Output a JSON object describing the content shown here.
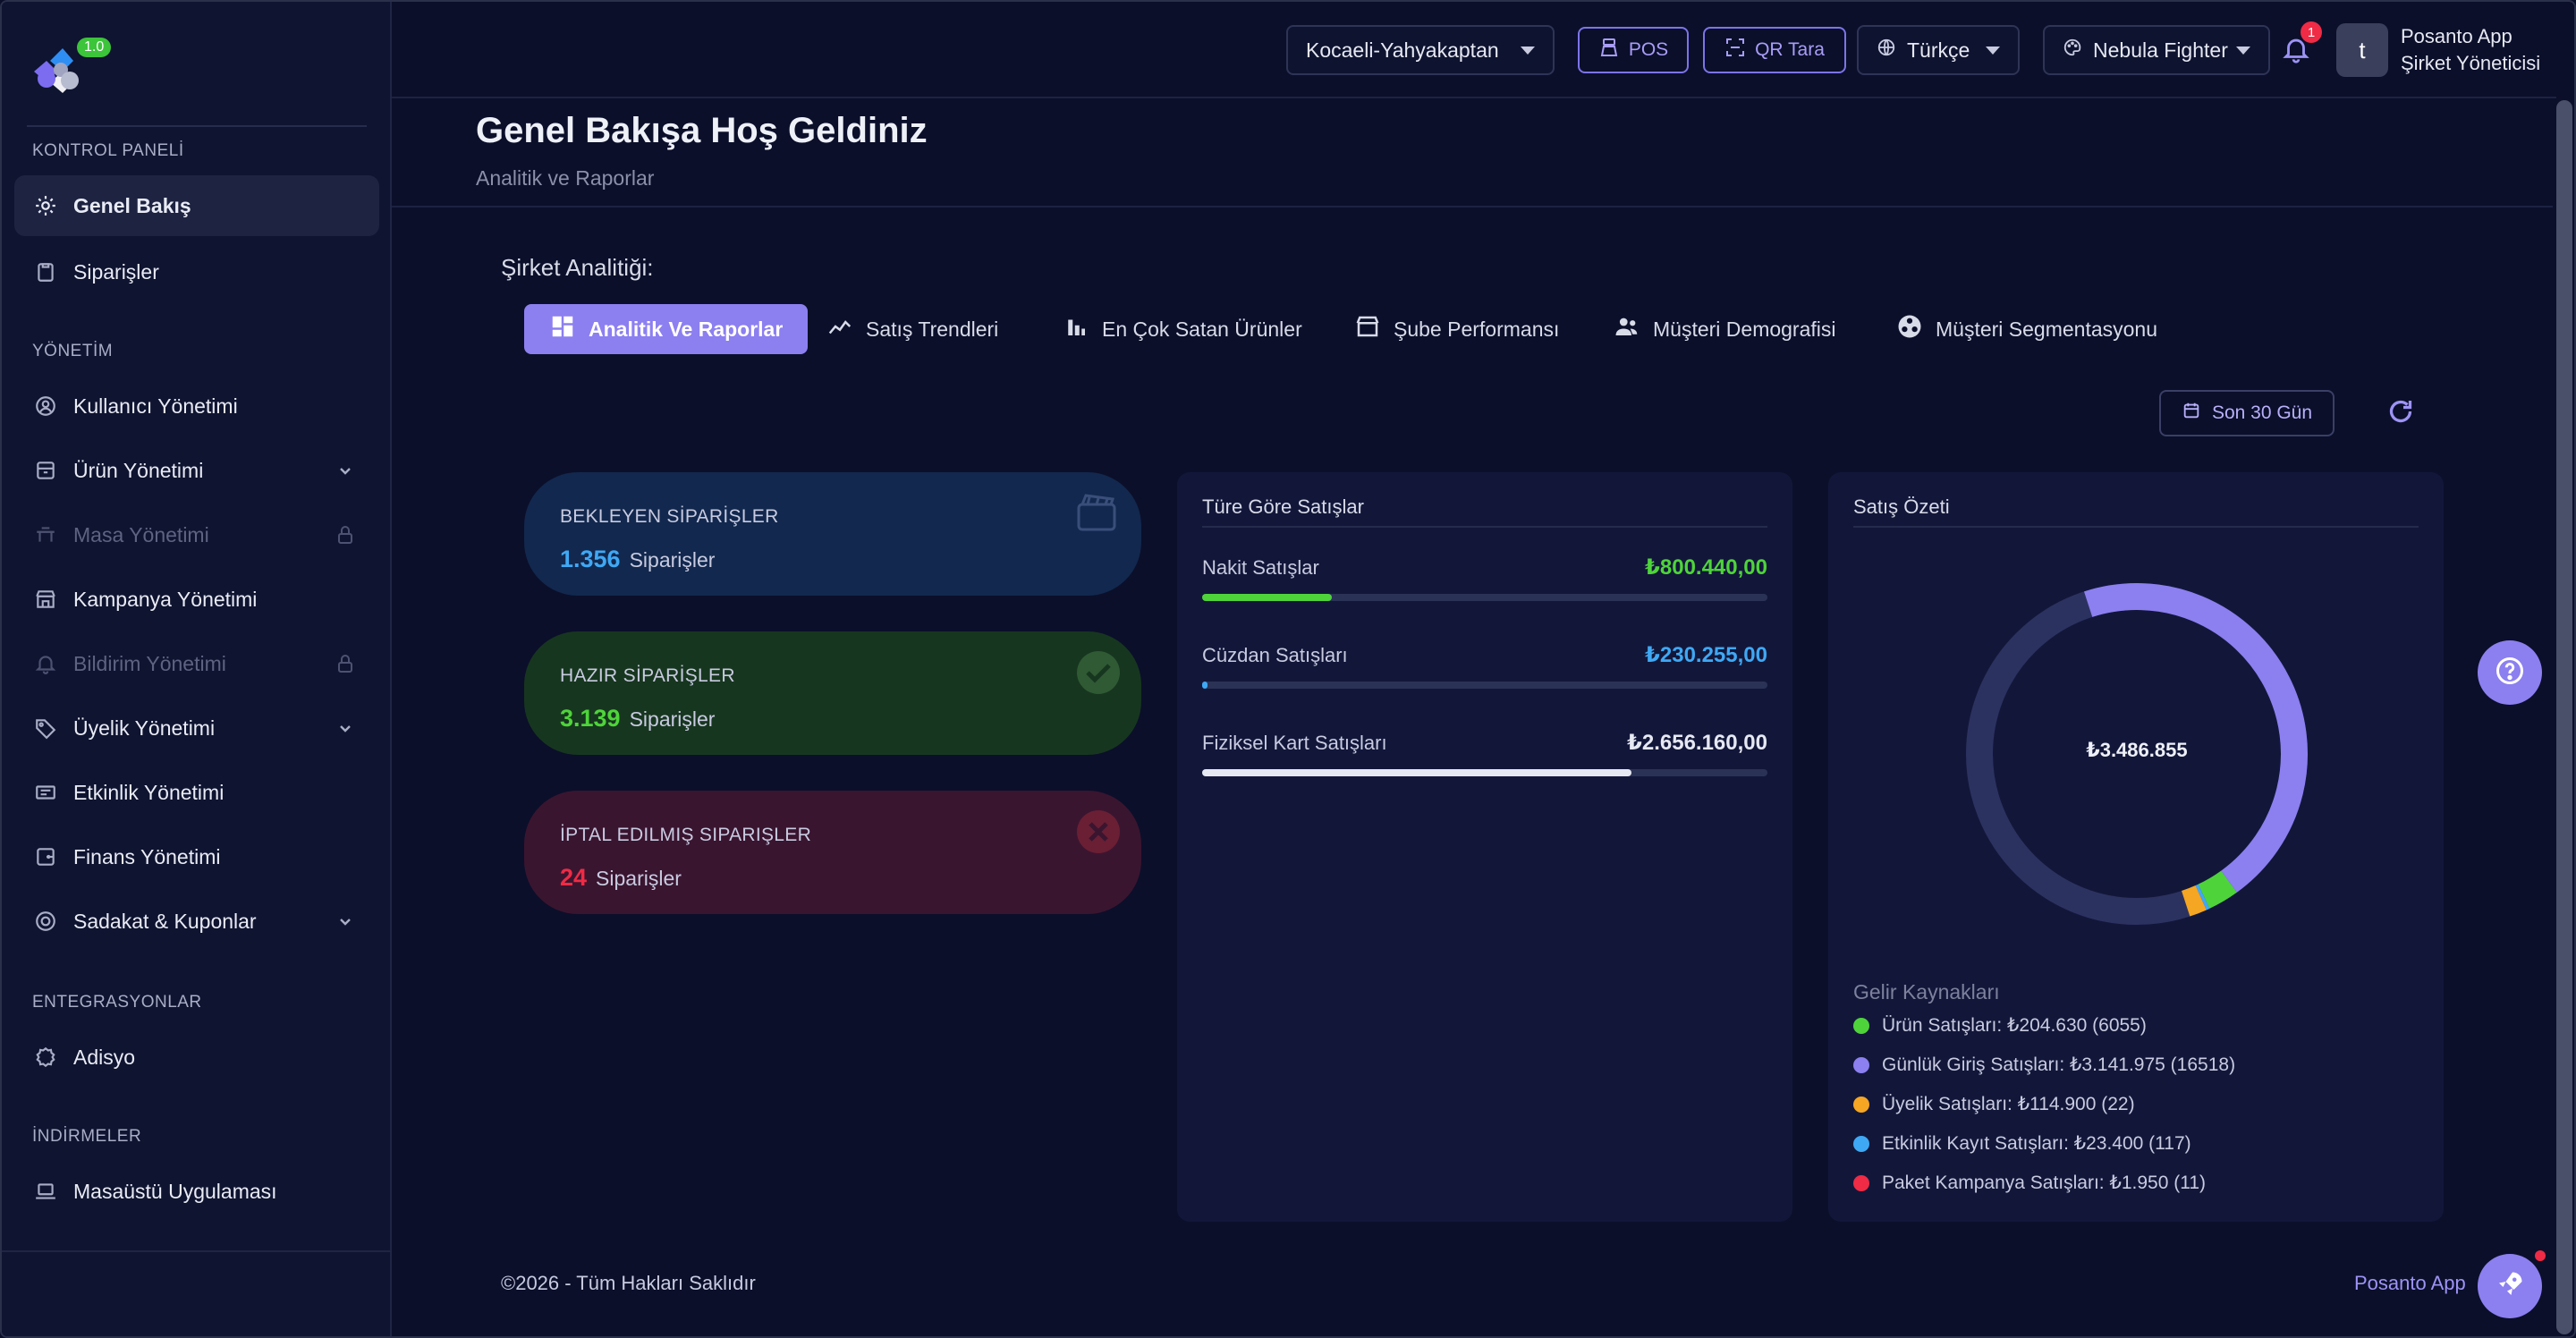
{
  "logo": {
    "version_badge": "1.0"
  },
  "sidebar": {
    "sections": [
      {
        "title": "KONTROL PANELİ"
      },
      {
        "title": "YÖNETİM"
      },
      {
        "title": "ENTEGRASYONLAR"
      },
      {
        "title": "İNDİRMELER"
      }
    ],
    "items": [
      {
        "label": "Genel Bakış",
        "icon": "gear-icon",
        "active": true
      },
      {
        "label": "Siparişler",
        "icon": "clipboard-icon"
      },
      {
        "label": "Kullanıcı Yönetimi",
        "icon": "user-circle-icon"
      },
      {
        "label": "Ürün Yönetimi",
        "icon": "box-icon",
        "expandable": true
      },
      {
        "label": "Masa Yönetimi",
        "icon": "lock-icon",
        "disabled": true
      },
      {
        "label": "Kampanya Yönetimi",
        "icon": "store-icon"
      },
      {
        "label": "Bildirim Yönetimi",
        "icon": "bell-icon",
        "disabled": true
      },
      {
        "label": "Üyelik Yönetimi",
        "icon": "tag-icon",
        "expandable": true
      },
      {
        "label": "Etkinlik Yönetimi",
        "icon": "ticket-icon"
      },
      {
        "label": "Finans Yönetimi",
        "icon": "wallet-icon"
      },
      {
        "label": "Sadakat & Kuponlar",
        "icon": "coupon-icon",
        "expandable": true
      },
      {
        "label": "Adisyo",
        "icon": "badge-icon"
      },
      {
        "label": "Masaüstü Uygulaması",
        "icon": "laptop-icon"
      }
    ]
  },
  "header": {
    "branch": "Kocaeli-Yahyakaptan",
    "pos_label": "POS",
    "qr_label": "QR Tara",
    "language": "Türkçe",
    "theme": "Nebula Fighter",
    "notification_count": "1",
    "avatar_letter": "t",
    "user_name": "Posanto App",
    "user_role": "Şirket Yöneticisi"
  },
  "page": {
    "title": "Genel Bakışa Hoş Geldiniz",
    "subtitle": "Analitik ve Raporlar",
    "section_label": "Şirket Analitiği:"
  },
  "tabs": [
    {
      "label": "Analitik Ve Raporlar",
      "icon": "dashboard-icon",
      "active": true
    },
    {
      "label": "Satış Trendleri",
      "icon": "trend-icon"
    },
    {
      "label": "En Çok Satan Ürünler",
      "icon": "bar-chart-icon"
    },
    {
      "label": "Şube Performansı",
      "icon": "store-front-icon"
    },
    {
      "label": "Müşteri Demografisi",
      "icon": "people-icon"
    },
    {
      "label": "Müşteri Segmentasyonu",
      "icon": "segment-icon"
    }
  ],
  "filters": {
    "date_range": "Son 30 Gün"
  },
  "status_cards": [
    {
      "label": "BEKLEYEN SİPARİŞLER",
      "count": "1.356",
      "unit": "Siparişler",
      "color": "#3fa8f4",
      "bg": "#12284e",
      "icon": "pending-icon"
    },
    {
      "label": "HAZIR SİPARİŞLER",
      "count": "3.139",
      "unit": "Siparişler",
      "color": "#4ed43a",
      "bg": "#17361f",
      "icon": "check-icon"
    },
    {
      "label": "İPTAL EDILMIŞ SIPARIŞLER",
      "count": "24",
      "unit": "Siparişler",
      "color": "#ef2b45",
      "bg": "#3a1530",
      "icon": "cancel-icon"
    }
  ],
  "sales_by_type": {
    "title": "Türe Göre Satışlar",
    "rows": [
      {
        "name": "Nakit Satışlar",
        "amount": "₺800.440,00",
        "color": "#4ed43a",
        "fraction": 0.23
      },
      {
        "name": "Cüzdan Satışları",
        "amount": "₺230.255,00",
        "color": "#3fa8f4",
        "fraction": 0.01
      },
      {
        "name": "Fiziksel Kart Satışları",
        "amount": "₺2.656.160,00",
        "color": "#e6e8f2",
        "fraction": 0.76
      }
    ]
  },
  "sales_summary": {
    "title": "Satış Özeti",
    "total": "₺3.486.855",
    "legend_title": "Gelir Kaynakları",
    "sources": [
      {
        "label": "Ürün Satışları: ₺204.630 (6055)",
        "color": "#4ed43a",
        "value": 204630
      },
      {
        "label": "Günlük Giriş Satışları: ₺3.141.975 (16518)",
        "color": "#8c7ff0",
        "value": 3141975
      },
      {
        "label": "Üyelik Satışları: ₺114.900 (22)",
        "color": "#f5a623",
        "value": 114900
      },
      {
        "label": "Etkinlik Kayıt Satışları: ₺23.400 (117)",
        "color": "#3fa8f4",
        "value": 23400
      },
      {
        "label": "Paket Kampanya Satışları: ₺1.950 (11)",
        "color": "#ef2b45",
        "value": 1950
      }
    ]
  },
  "footer": {
    "copyright": "©2026 - Tüm Hakları Saklıdır",
    "brand": "Posanto App"
  }
}
